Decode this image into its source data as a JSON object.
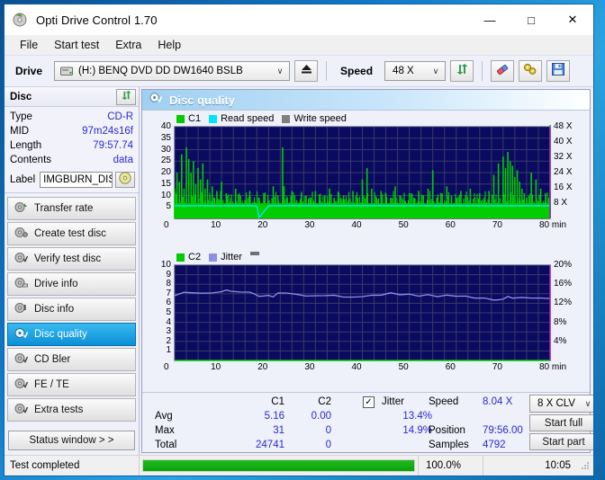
{
  "window": {
    "title": "Opti Drive Control 1.70",
    "app_icon": "disc-icon",
    "minimize": "—",
    "maximize": "□",
    "close": "✕"
  },
  "menu": {
    "items": [
      "File",
      "Start test",
      "Extra",
      "Help"
    ]
  },
  "toolbar": {
    "drive_label": "Drive",
    "drive_value": "(H:)  BENQ DVD DD DW1640 BSLB",
    "eject_icon": "eject-icon",
    "speed_label": "Speed",
    "speed_value": "48 X",
    "refresh_icon": "refresh-icon",
    "erase_icon": "eraser-icon",
    "tools_icon": "tools-icon",
    "save_icon": "save-icon",
    "arrow": "∨"
  },
  "disc": {
    "header": "Disc",
    "refresh_icon": "refresh-disc-icon",
    "rows": [
      {
        "key": "Type",
        "value": "CD-R"
      },
      {
        "key": "MID",
        "value": "97m24s16f"
      },
      {
        "key": "Length",
        "value": "79:57.74"
      },
      {
        "key": "Contents",
        "value": "data"
      }
    ],
    "label_key": "Label",
    "label_value": "IMGBURN_DIS",
    "label_button_icon": "cd-icon"
  },
  "nav": {
    "items": [
      {
        "label": "Transfer rate",
        "icon": "disc-transfer-icon",
        "active": false
      },
      {
        "label": "Create test disc",
        "icon": "disc-create-icon",
        "active": false
      },
      {
        "label": "Verify test disc",
        "icon": "disc-verify-icon",
        "active": false
      },
      {
        "label": "Drive info",
        "icon": "disc-drive-icon",
        "active": false
      },
      {
        "label": "Disc info",
        "icon": "disc-info-icon",
        "active": false
      },
      {
        "label": "Disc quality",
        "icon": "disc-quality-icon",
        "active": true
      },
      {
        "label": "CD Bler",
        "icon": "disc-bler-icon",
        "active": false
      },
      {
        "label": "FE / TE",
        "icon": "disc-fete-icon",
        "active": false
      },
      {
        "label": "Extra tests",
        "icon": "disc-extra-icon",
        "active": false
      }
    ],
    "status_window_button": "Status window > >"
  },
  "main": {
    "title": "Disc quality",
    "title_icon": "disc-quality-icon"
  },
  "stats": {
    "col_c1": "C1",
    "col_c2": "C2",
    "rows": [
      {
        "key": "Avg",
        "c1": "5.16",
        "c2": "0.00",
        "jitter": "13.4%"
      },
      {
        "key": "Max",
        "c1": "31",
        "c2": "0",
        "jitter": "14.9%"
      },
      {
        "key": "Total",
        "c1": "24741",
        "c2": "0",
        "jitter": ""
      }
    ],
    "jitter_label": "Jitter",
    "jitter_checked": "✓",
    "speed_key": "Speed",
    "speed_value": "8.04 X",
    "position_key": "Position",
    "position_value": "79:56.00",
    "samples_key": "Samples",
    "samples_value": "4792",
    "write_mode": "8 X CLV",
    "write_mode_arrow": "∨",
    "start_full": "Start full",
    "start_part": "Start part"
  },
  "statusbar": {
    "text": "Test completed",
    "percent_label": "100.0%",
    "percent_value": 100,
    "time": "10:05"
  },
  "colors": {
    "c1": "#00cc00",
    "c2": "#00cc00",
    "read_speed": "#00e5ff",
    "write_speed": "#808080",
    "jitter": "#8f8fe8",
    "plot_bg": "#0a0a5e",
    "accent": "#2a2ad0",
    "progress": "#06a206"
  },
  "chart_data": [
    {
      "type": "area",
      "title": "C1 error rate / Read speed",
      "legend": [
        {
          "label": "C1",
          "color": "#00cc00"
        },
        {
          "label": "Read speed",
          "color": "#00e5ff"
        },
        {
          "label": "Write speed",
          "color": "#808080"
        }
      ],
      "legend_position": "top-left",
      "xlabel": "80 min",
      "x_ticks": [
        "0",
        "10",
        "20",
        "30",
        "40",
        "50",
        "60",
        "70",
        "80 min"
      ],
      "xlim": [
        0,
        80
      ],
      "ylabel_left": "C1",
      "y_ticks_left": [
        "5",
        "10",
        "15",
        "20",
        "25",
        "30",
        "35",
        "40"
      ],
      "ylim_left": [
        0,
        40
      ],
      "ylabel_right": "Speed",
      "y_ticks_right": [
        "8 X",
        "16 X",
        "24 X",
        "32 X",
        "40 X",
        "48 X"
      ],
      "ylim_right": [
        0,
        48
      ],
      "grid": true,
      "series": [
        {
          "name": "C1",
          "color": "#00cc00",
          "x": [
            0,
            0.5,
            1,
            1.5,
            2,
            2.5,
            3,
            3.5,
            4,
            4.5,
            5,
            5.5,
            6,
            6.5,
            7,
            7.5,
            8,
            8.5,
            9,
            9.5,
            10,
            11,
            12,
            13,
            14,
            15,
            16,
            17,
            17.5,
            18,
            19,
            20,
            21,
            22,
            23,
            23.3,
            24,
            25,
            26,
            27,
            28,
            29,
            30,
            31,
            32,
            33,
            34,
            35,
            36,
            37,
            38,
            39,
            40,
            41,
            42,
            43,
            44,
            45,
            46,
            47,
            48,
            49,
            50,
            51,
            52,
            53,
            54,
            55,
            56,
            57,
            58,
            59,
            60,
            61,
            62,
            63,
            64,
            65,
            66,
            67,
            68,
            69,
            70,
            70.5,
            71,
            71.5,
            72,
            72.5,
            73,
            73.5,
            74,
            74.5,
            75,
            76,
            77,
            78,
            79,
            80
          ],
          "values": [
            13,
            20,
            16,
            28,
            13,
            31,
            26,
            20,
            25,
            15,
            22,
            17,
            24,
            13,
            17,
            10,
            14,
            9,
            12,
            8,
            16,
            11,
            9,
            13,
            10,
            8,
            12,
            7,
            4,
            9,
            11,
            8,
            14,
            10,
            31,
            14,
            9,
            12,
            8,
            11,
            10,
            9,
            12,
            8,
            10,
            13,
            9,
            11,
            10,
            8,
            12,
            9,
            17,
            22,
            13,
            9,
            12,
            11,
            9,
            14,
            10,
            8,
            11,
            9,
            12,
            10,
            13,
            21,
            9,
            11,
            14,
            10,
            9,
            12,
            10,
            13,
            9,
            11,
            8,
            12,
            19,
            24,
            27,
            22,
            29,
            25,
            23,
            18,
            21,
            16,
            13,
            11,
            9,
            20,
            17,
            13,
            11
          ]
        },
        {
          "name": "Read speed",
          "color": "#00e5ff",
          "x": [
            0,
            5,
            10,
            15,
            17.5,
            18,
            20,
            25,
            30,
            35,
            40,
            45,
            50,
            55,
            60,
            65,
            70,
            75,
            80
          ],
          "values": [
            6.6,
            6.6,
            6.6,
            6.6,
            6.6,
            0.5,
            6.6,
            6.6,
            6.6,
            6.6,
            6.6,
            6.6,
            6.6,
            6.6,
            6.6,
            6.6,
            6.6,
            6.6,
            6.6
          ]
        }
      ]
    },
    {
      "type": "line",
      "title": "C2 errors / Jitter",
      "legend": [
        {
          "label": "C2",
          "color": "#00cc00"
        },
        {
          "label": "Jitter",
          "color": "#8f8fe8"
        }
      ],
      "legend_position": "top-left",
      "xlabel": "80 min",
      "x_ticks": [
        "0",
        "10",
        "20",
        "30",
        "40",
        "50",
        "60",
        "70",
        "80 min"
      ],
      "xlim": [
        0,
        80
      ],
      "ylabel_left": "C2",
      "y_ticks_left": [
        "1",
        "2",
        "3",
        "4",
        "5",
        "6",
        "7",
        "8",
        "9",
        "10"
      ],
      "ylim_left": [
        0,
        10
      ],
      "ylabel_right": "Jitter",
      "y_ticks_right": [
        "4%",
        "8%",
        "12%",
        "16%",
        "20%"
      ],
      "ylim_right": [
        0,
        20
      ],
      "grid": true,
      "series": [
        {
          "name": "C2",
          "color": "#00cc00",
          "x": [
            0,
            80
          ],
          "values": [
            0,
            0
          ]
        },
        {
          "name": "Jitter",
          "color": "#8f8fe8",
          "x": [
            0,
            2,
            4,
            6,
            8,
            10,
            11,
            12,
            14,
            16,
            17,
            18,
            19,
            20,
            21,
            22,
            24,
            26,
            28,
            30,
            32,
            34,
            36,
            38,
            40,
            42,
            44,
            46,
            48,
            50,
            52,
            54,
            56,
            58,
            60,
            62,
            64,
            66,
            68,
            69,
            70,
            71,
            72,
            74,
            76,
            78,
            80
          ],
          "values": [
            13.6,
            14.3,
            14.2,
            14.1,
            14.2,
            14.4,
            14.8,
            14.5,
            14.4,
            14.3,
            14.0,
            13.4,
            13.6,
            13.6,
            13.4,
            14.1,
            14.2,
            13.8,
            13.6,
            13.5,
            13.7,
            13.6,
            13.4,
            13.2,
            13.5,
            13.6,
            13.8,
            14.1,
            13.9,
            13.8,
            13.6,
            13.7,
            13.5,
            13.6,
            13.6,
            13.4,
            13.2,
            13.0,
            12.8,
            12.6,
            13.0,
            13.3,
            13.2,
            13.1,
            13.2,
            13.0,
            13.1
          ]
        }
      ]
    }
  ]
}
